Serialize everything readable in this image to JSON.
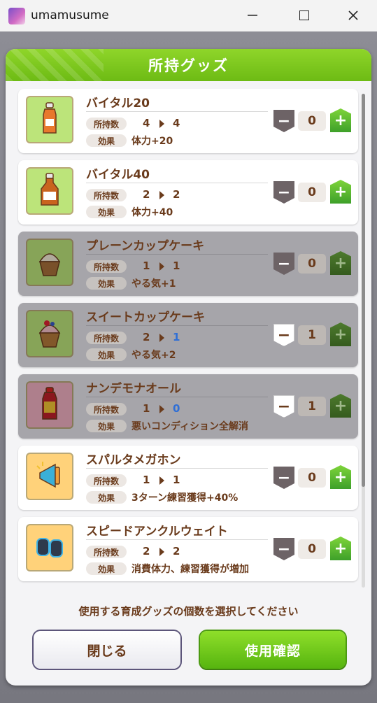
{
  "window": {
    "title": "umamusume"
  },
  "dialog": {
    "title": "所持グッズ",
    "instruction": "使用する育成グッズの個数を選択してください",
    "close_label": "閉じる",
    "confirm_label": "使用確認"
  },
  "labels": {
    "owned": "所持数",
    "effect": "効果",
    "minus": "−",
    "plus": "+"
  },
  "items": [
    {
      "name": "バイタル20",
      "owned_from": "4",
      "owned_to": "4",
      "effect": "体力+20",
      "qty": "0",
      "disabled": false,
      "icon": "small-bottle-icon",
      "thumb": "green"
    },
    {
      "name": "バイタル40",
      "owned_from": "2",
      "owned_to": "2",
      "effect": "体力+40",
      "qty": "0",
      "disabled": false,
      "icon": "bottle-icon",
      "thumb": "green"
    },
    {
      "name": "プレーンカップケーキ",
      "owned_from": "1",
      "owned_to": "1",
      "effect": "やる気+1",
      "qty": "0",
      "disabled": true,
      "icon": "cupcake-icon",
      "thumb": "green"
    },
    {
      "name": "スイートカップケーキ",
      "owned_from": "2",
      "owned_to": "1",
      "effect": "やる気+2",
      "qty": "1",
      "disabled": true,
      "icon": "sweet-cupcake-icon",
      "thumb": "green"
    },
    {
      "name": "ナンデモナオール",
      "owned_from": "1",
      "owned_to": "0",
      "effect": "悪いコンディション全解消",
      "qty": "1",
      "disabled": true,
      "icon": "medicine-bottle-icon",
      "thumb": "pink"
    },
    {
      "name": "スパルタメガホン",
      "owned_from": "1",
      "owned_to": "1",
      "effect": "3ターン練習獲得+40%",
      "qty": "0",
      "disabled": false,
      "icon": "megaphone-icon",
      "thumb": "yellow"
    },
    {
      "name": "スピードアンクルウェイト",
      "owned_from": "2",
      "owned_to": "2",
      "effect": "消費体力、練習獲得が増加",
      "qty": "0",
      "disabled": false,
      "icon": "ankle-weight-icon",
      "thumb": "yellow"
    }
  ],
  "colors": {
    "accent_green": "#6dbb14",
    "text_brown": "#6a3b1c",
    "changed_count_blue": "#2f6fd6"
  }
}
